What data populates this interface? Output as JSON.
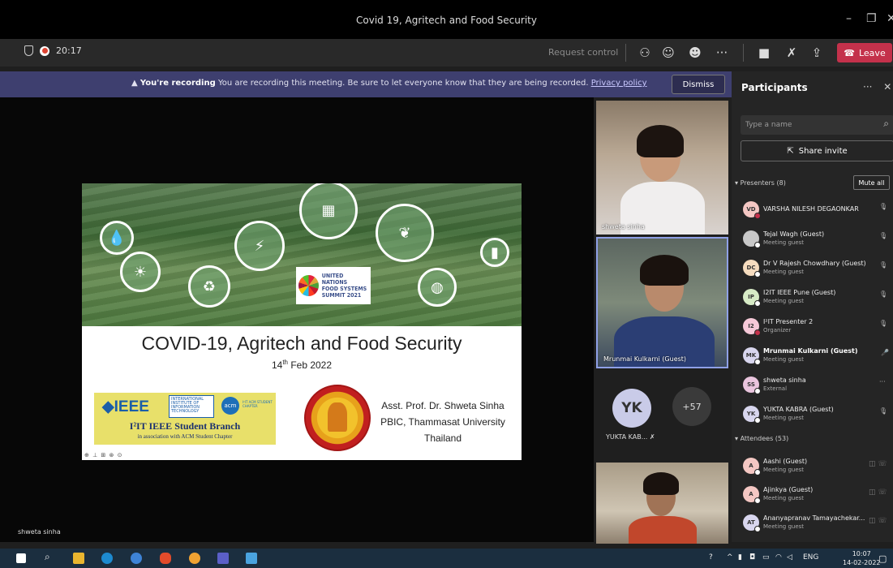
{
  "window": {
    "title": "Covid 19, Agritech and Food Security",
    "controls": [
      "–",
      "❐",
      "✕"
    ]
  },
  "toolbar": {
    "timer": "20:17",
    "request_control": "Request control",
    "leave_label": "Leave"
  },
  "banner": {
    "bold": "You're recording",
    "text": "You are recording this meeting. Be sure to let everyone know that they are being recorded.",
    "link": "Privacy policy",
    "dismiss": "Dismiss"
  },
  "slide": {
    "title": "COVID-19, Agritech and Food Security",
    "date_main": "14",
    "date_sup": "th",
    "date_rest": " Feb 2022",
    "un_logo": [
      "UNITED NATIONS",
      "FOOD SYSTEMS",
      "SUMMIT 2021"
    ],
    "ieee_logo": "◆IEEE",
    "i2it_text": "INTERNATIONAL INSTITUTE OF INFORMATION TECHNOLOGY",
    "acm_logo": "acm",
    "acm_text": "I²IT ACM STUDENT CHAPTER",
    "branch": "I²IT IEEE Student Branch",
    "assoc": "in association with ACM Student Chapter",
    "speaker": [
      "Asst. Prof. Dr. Shweta Sinha",
      "PBIC, Thammasat University",
      "Thailand"
    ],
    "cc_icons": "⊕ ⊥ ⊞ ⊛ ⊙"
  },
  "stage": {
    "presenter_name": "shweta sinha"
  },
  "gallery": {
    "tile1_name": "shweta sinha",
    "tile2_name": "Mrunmai Kulkarni (Guest)",
    "yk_initials": "YK",
    "yk_label": "YUKTA KAB...",
    "more_count": "+57"
  },
  "panel": {
    "title": "Participants",
    "search_placeholder": "Type a name",
    "share_invite": "Share invite",
    "presenters_label": "Presenters (8)",
    "mute_all": "Mute all",
    "attendees_label": "Attendees (53)",
    "presenters": [
      {
        "initials": "VD",
        "name": "VARSHA NILESH DEGAONKAR",
        "sub": "",
        "color": "#f4c7c3",
        "status": "red",
        "mic": "🎙"
      },
      {
        "initials": "",
        "name": "Tejal Wagh (Guest)",
        "sub": "Meeting guest",
        "color": "#c8c8c8",
        "status": "white",
        "mic": "🎙"
      },
      {
        "initials": "DC",
        "name": "Dr V Rajesh Chowdhary (Guest)",
        "sub": "Meeting guest",
        "color": "#f6dcbf",
        "status": "white",
        "mic": "🎙"
      },
      {
        "initials": "IP",
        "name": "I2IT IEEE Pune (Guest)",
        "sub": "Meeting guest",
        "color": "#d7ebc6",
        "status": "white",
        "mic": "🎙"
      },
      {
        "initials": "I2",
        "name": "I²IT Presenter 2",
        "sub": "Organizer",
        "color": "#f6c9d8",
        "status": "red",
        "mic": "🎙"
      },
      {
        "initials": "MK",
        "name": "Mrunmai Kulkarni (Guest)",
        "sub": "Meeting guest",
        "color": "#d8d6ee",
        "status": "white",
        "mic": "🎤"
      },
      {
        "initials": "SS",
        "name": "shweta sinha",
        "sub": "External",
        "color": "#eac5de",
        "status": "white",
        "mic": "···"
      },
      {
        "initials": "YK",
        "name": "YUKTA KABRA (Guest)",
        "sub": "Meeting guest",
        "color": "#d8d6ee",
        "status": "white",
        "mic": "🎙"
      }
    ],
    "attendees": [
      {
        "initials": "A",
        "name": "Aashi (Guest)",
        "sub": "Meeting guest",
        "color": "#f4c7c3"
      },
      {
        "initials": "A",
        "name": "Ajinkya (Guest)",
        "sub": "Meeting guest",
        "color": "#f4c7c3"
      },
      {
        "initials": "AT",
        "name": "Ananyapranav Tamayachekar...",
        "sub": "Meeting guest",
        "color": "#d8d6ee"
      }
    ]
  },
  "taskbar": {
    "lang": "ENG",
    "time": "10:07",
    "date": "14-02-2022"
  }
}
